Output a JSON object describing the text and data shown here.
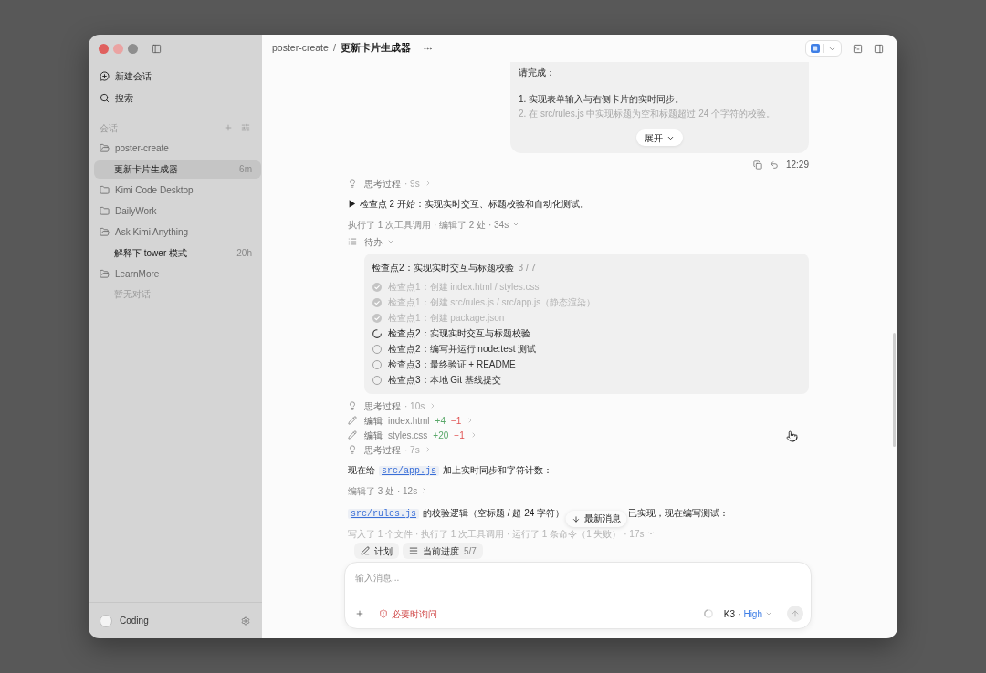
{
  "sidebar": {
    "actions": [
      {
        "kind": "new_chat",
        "label": "新建会话"
      },
      {
        "kind": "search",
        "label": "搜索"
      }
    ],
    "section_label": "会话",
    "groups": [
      {
        "label": "poster-create",
        "expanded": true,
        "children": [
          {
            "label": "更新卡片生成器",
            "time": "6m",
            "selected": true
          }
        ]
      },
      {
        "label": "Kimi Code Desktop",
        "expanded": false
      },
      {
        "label": "DailyWork",
        "expanded": false
      },
      {
        "label": "Ask Kimi Anything",
        "expanded": true,
        "children": [
          {
            "label": "解释下 tower 模式",
            "time": "20h",
            "selected": false
          }
        ]
      },
      {
        "label": "LearnMore",
        "expanded": true,
        "empty_note": "暂无对话"
      }
    ],
    "user": {
      "name": "Coding"
    }
  },
  "header": {
    "breadcrumb": [
      {
        "label": "poster-create",
        "current": false
      },
      {
        "label": "更新卡片生成器",
        "current": true
      }
    ],
    "separator": "/"
  },
  "user_message": {
    "heading": "请完成：",
    "items": [
      "1. 实现表单输入与右侧卡片的实时同步。",
      "2. 在 src/rules.js 中实现标题为空和标题超过 24 个字符的校验。"
    ],
    "collapsed": true,
    "expand_label": "展开",
    "time": "12:29"
  },
  "transcript": [
    {
      "kind": "thinking",
      "label": "思考过程",
      "duration": "· 9s"
    },
    {
      "kind": "paragraph",
      "parts": [
        {
          "kind": "text",
          "text": "▶ 检查点 2 开始：实现实时交互、标题校验和自动化测试。"
        }
      ]
    },
    {
      "kind": "tool_summary",
      "text": "执行了 1 次工具调用 · 编辑了 2 处 · 34s",
      "faded": false
    },
    {
      "kind": "todo",
      "label": "待办",
      "expanded": true,
      "title": "检查点2：实现实时交互与标题校验",
      "count": "3 / 7",
      "items": [
        {
          "text": "检查点1：创建 index.html / styles.css",
          "kind": "done"
        },
        {
          "text": "检查点1：创建 src/rules.js / src/app.js（静态渲染）",
          "kind": "done"
        },
        {
          "text": "检查点1：创建 package.json",
          "kind": "done"
        },
        {
          "text": "检查点2：实现实时交互与标题校验",
          "kind": "active"
        },
        {
          "text": "检查点2：编写并运行 node:test 测试",
          "kind": "pending"
        },
        {
          "text": "检查点3：最终验证 + README",
          "kind": "pending"
        },
        {
          "text": "检查点3：本地 Git 基线提交",
          "kind": "pending"
        }
      ]
    },
    {
      "kind": "thinking",
      "label": "思考过程",
      "duration": "· 10s"
    },
    {
      "kind": "edit",
      "label": "编辑",
      "file": "index.html",
      "added": "+4",
      "removed": "−1"
    },
    {
      "kind": "edit",
      "label": "编辑",
      "file": "styles.css",
      "added": "+20",
      "removed": "−1"
    },
    {
      "kind": "thinking",
      "label": "思考过程",
      "duration": "· 7s"
    },
    {
      "kind": "paragraph",
      "parts": [
        {
          "kind": "text",
          "text": "现在给"
        },
        {
          "kind": "code",
          "text": "src/app.js"
        },
        {
          "kind": "text",
          "text": "加上实时同步和字符计数："
        }
      ]
    },
    {
      "kind": "edit_summary",
      "text": "编辑了 3 处 · 12s"
    },
    {
      "kind": "paragraph",
      "parts": [
        {
          "kind": "code",
          "text": "src/rules.js"
        },
        {
          "kind": "text",
          "text": "的校验逻辑（空标题 / 超 24 字符）"
        },
        {
          "kind": "covered"
        },
        {
          "kind": "text",
          "text": "已实现，现在编写测试："
        }
      ]
    },
    {
      "kind": "tool_summary",
      "text": "写入了 1 个文件 · 执行了 1 次工具调用 · 运行了 1 条命令（1 失败） · 17s",
      "faded": true
    }
  ],
  "jump_to_latest": {
    "label": "最新消息"
  },
  "chips": [
    {
      "kind": "plan",
      "label": "计划"
    },
    {
      "kind": "progress",
      "label": "当前进度",
      "count": "5/7"
    }
  ],
  "composer": {
    "placeholder": "输入消息...",
    "permission": "必要时询问",
    "model": "K3",
    "separator": "·",
    "effort": "High"
  }
}
